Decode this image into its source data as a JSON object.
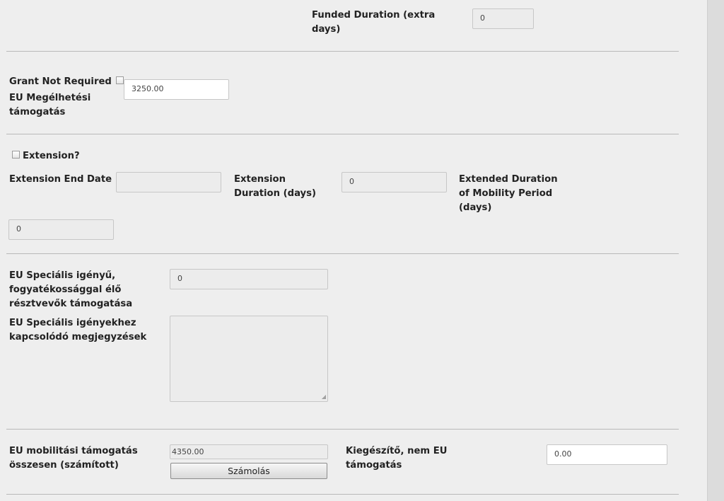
{
  "funded_duration": {
    "label": "Funded Duration (extra days)",
    "value": "0"
  },
  "grant": {
    "not_required_label": "Grant Not Required",
    "not_required_checked": false,
    "eu_subsistence_label": "EU Megélhetési támogatás",
    "eu_subsistence_value": "3250.00"
  },
  "extension": {
    "checkbox_label": "Extension?",
    "checked": false,
    "end_date_label": "Extension End Date",
    "end_date_value": "",
    "duration_label": "Extension Duration (days)",
    "duration_value": "0",
    "extended_label": "Extended Duration of Mobility Period (days)",
    "extended_value": "0"
  },
  "special_needs": {
    "support_label": "EU Speciális igényű, fogyatékossággal élő résztvevők támogatása",
    "support_value": "0",
    "remarks_label": "EU Speciális igényekhez kapcsolódó megjegyzések",
    "remarks_value": ""
  },
  "total": {
    "label": "EU mobilitási támogatás összesen (számított)",
    "value": "4350.00",
    "calc_button": "Számolás",
    "supplementary_label": "Kiegészítő, nem EU támogatás",
    "supplementary_value": "0.00"
  }
}
